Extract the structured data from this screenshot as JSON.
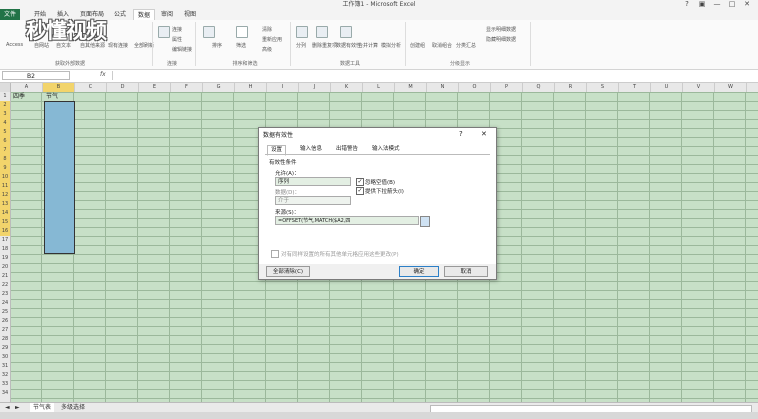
{
  "window": {
    "title": "工作簿1 - Microsoft Excel"
  },
  "window_buttons": [
    "?",
    "▣",
    "—",
    "□",
    "✕"
  ],
  "tabs": [
    "文件",
    "开始",
    "插入",
    "页面布局",
    "公式",
    "数据",
    "审阅",
    "视图"
  ],
  "logo_text": "秒懂视频",
  "ribbon": {
    "get_external": {
      "items": [
        "Access",
        "自网站",
        "自文本",
        "自其他来源",
        "现有连接",
        "全部刷新"
      ],
      "label": "获取外部数据"
    },
    "connections": {
      "items": [
        "连接",
        "属性",
        "编辑链接"
      ],
      "label": "连接"
    },
    "sort_filter": {
      "items": [
        "排序",
        "筛选",
        "清除",
        "重新应用",
        "高级"
      ],
      "label": "排序和筛选"
    },
    "data_tools": {
      "items": [
        "分列",
        "删除重复项",
        "数据有效性",
        "合并计算",
        "模拟分析"
      ],
      "label": "数据工具"
    },
    "outline": {
      "items": [
        "创建组",
        "取消组合",
        "分类汇总",
        "显示明细数据",
        "隐藏明细数据"
      ],
      "label": "分级显示"
    }
  },
  "formula_bar": {
    "name_box": "B2",
    "fx": "fx"
  },
  "columns": [
    "A",
    "B",
    "C",
    "D",
    "E",
    "F",
    "G",
    "H",
    "I",
    "J",
    "K",
    "L",
    "M",
    "N",
    "O",
    "P",
    "Q",
    "R",
    "S",
    "T",
    "U",
    "V",
    "W"
  ],
  "rows": [
    "1",
    "2",
    "3",
    "4",
    "5",
    "6",
    "7",
    "8",
    "9",
    "10",
    "11",
    "12",
    "13",
    "14",
    "15",
    "16",
    "17",
    "18",
    "19",
    "20",
    "21",
    "22",
    "23",
    "24",
    "25",
    "26",
    "27",
    "28",
    "29",
    "30",
    "31",
    "32",
    "33",
    "34"
  ],
  "cells": {
    "A1": "四季",
    "B1": "节气"
  },
  "sheets": [
    "节气表",
    "多级选择"
  ],
  "sheet_nav": [
    "◄",
    "►"
  ],
  "dialog": {
    "title": "数据有效性",
    "help": "?",
    "close": "✕",
    "tabs": [
      "设置",
      "输入信息",
      "出错警告",
      "输入法模式"
    ],
    "section": "有效性条件",
    "allow_label": "允许(A)：",
    "allow_value": "序列",
    "ignore_blank": "忽略空值(B)",
    "in_cell_dropdown": "提供下拉箭头(I)",
    "data_label": "数据(D)：",
    "data_value": "介于",
    "source_label": "来源(S)：",
    "source_value": "=OFFSET(节气,MATCH($A2,四季,0)-1,1,1,COUNTA(OFFSET(节气,MATCH($A2,四季",
    "apply_all": "对有同样设置的所有其他单元格应用这些更改(P)",
    "clear_all": "全部清除(C)",
    "ok": "确定",
    "cancel": "取消"
  }
}
